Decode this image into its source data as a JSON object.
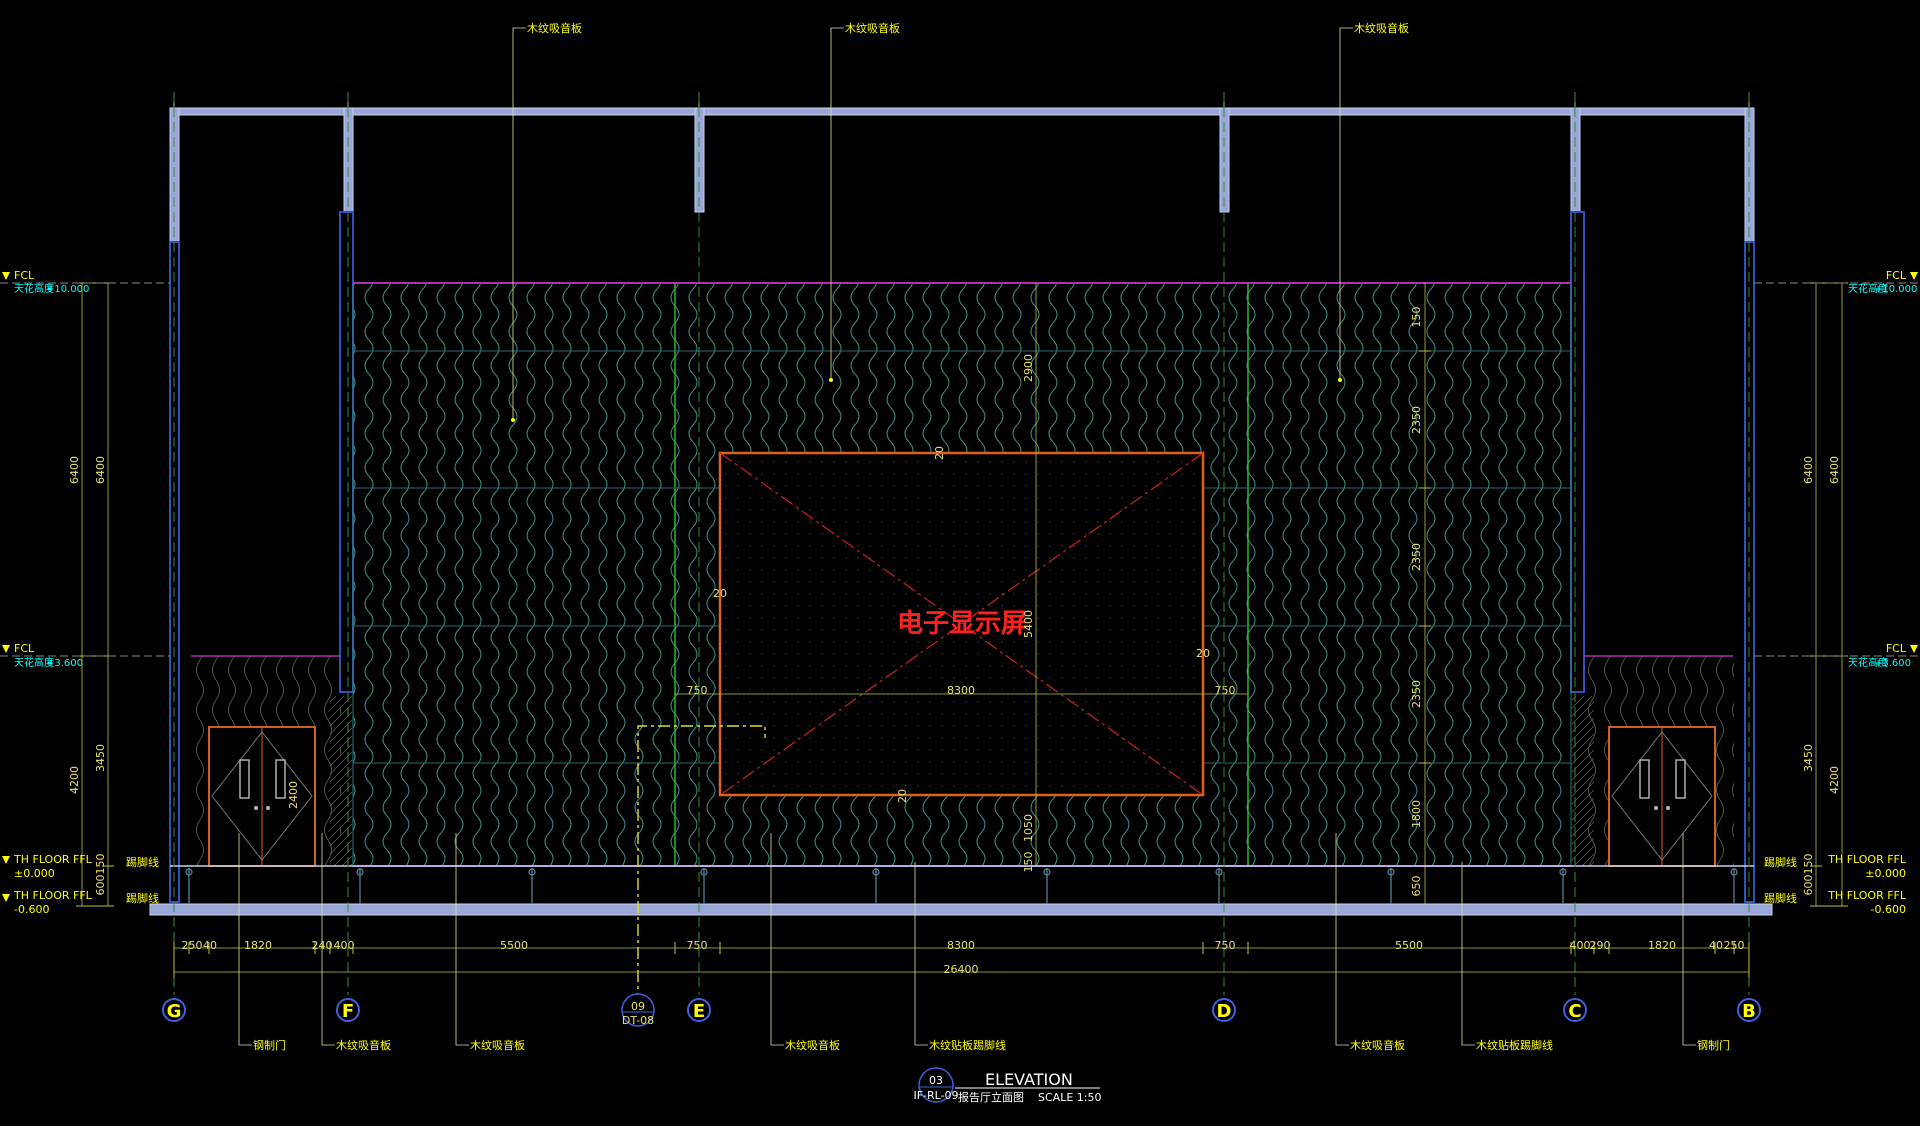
{
  "wall_labels": {
    "top_left": "木纹吸音板",
    "top_center": "木纹吸音板",
    "top_right": "木纹吸音板"
  },
  "screen": {
    "label": "电子显示屏",
    "width": "8300",
    "height": "5400",
    "edge_top": "20",
    "edge_bottom": "20",
    "edge_left": "20",
    "edge_right": "20",
    "side_left": "750",
    "side_right": "750"
  },
  "levels": {
    "ceiling": "FCL",
    "ceiling_label": "天花高度",
    "ceiling_value": "+10.000",
    "mid": "FCL",
    "mid_label": "天花高度",
    "mid_value": "+3.600",
    "floor1": "TH FLOOR FFL",
    "floor1_value": "±0.000",
    "floor2": "TH FLOOR FFL",
    "floor2_value": "-0.600"
  },
  "vertical_dims": {
    "upper": "6400",
    "lower": "4200",
    "door": "3450",
    "door_leaf": "2400",
    "base_a": "150",
    "base_b": "600",
    "center_top": "2900",
    "center_mid": "5400",
    "center_low": "1050",
    "center_base": "150",
    "right_stack": [
      "150",
      "2350",
      "2350",
      "2350",
      "1800",
      "650"
    ]
  },
  "horizontal_dims": {
    "row": [
      "250",
      "40",
      "1820",
      "240",
      "400",
      "5500",
      "750",
      "8300",
      "750",
      "5500",
      "400",
      "290",
      "1820",
      "40",
      "250"
    ],
    "total": "26400"
  },
  "grids": [
    "G",
    "F",
    "E",
    "D",
    "C",
    "B"
  ],
  "detail_tag": {
    "number": "09",
    "sheet": "DT-08"
  },
  "bottom_labels": {
    "door_left": "钢制门",
    "panel_f": "木纹吸音板",
    "panel_left": "木纹吸音板",
    "panel_center": "木纹吸音板",
    "skirting_center": "木纹贴板踢脚线",
    "panel_right": "木纹吸音板",
    "skirting_right": "木纹贴板踢脚线",
    "door_right": "钢制门"
  },
  "small_labels": {
    "base_tag": "踢脚线"
  },
  "title": {
    "number": "03",
    "sheet": "IF-RL-09",
    "main": "ELEVATION",
    "sub": "报告厅立面图",
    "scale": "SCALE  1:50"
  }
}
